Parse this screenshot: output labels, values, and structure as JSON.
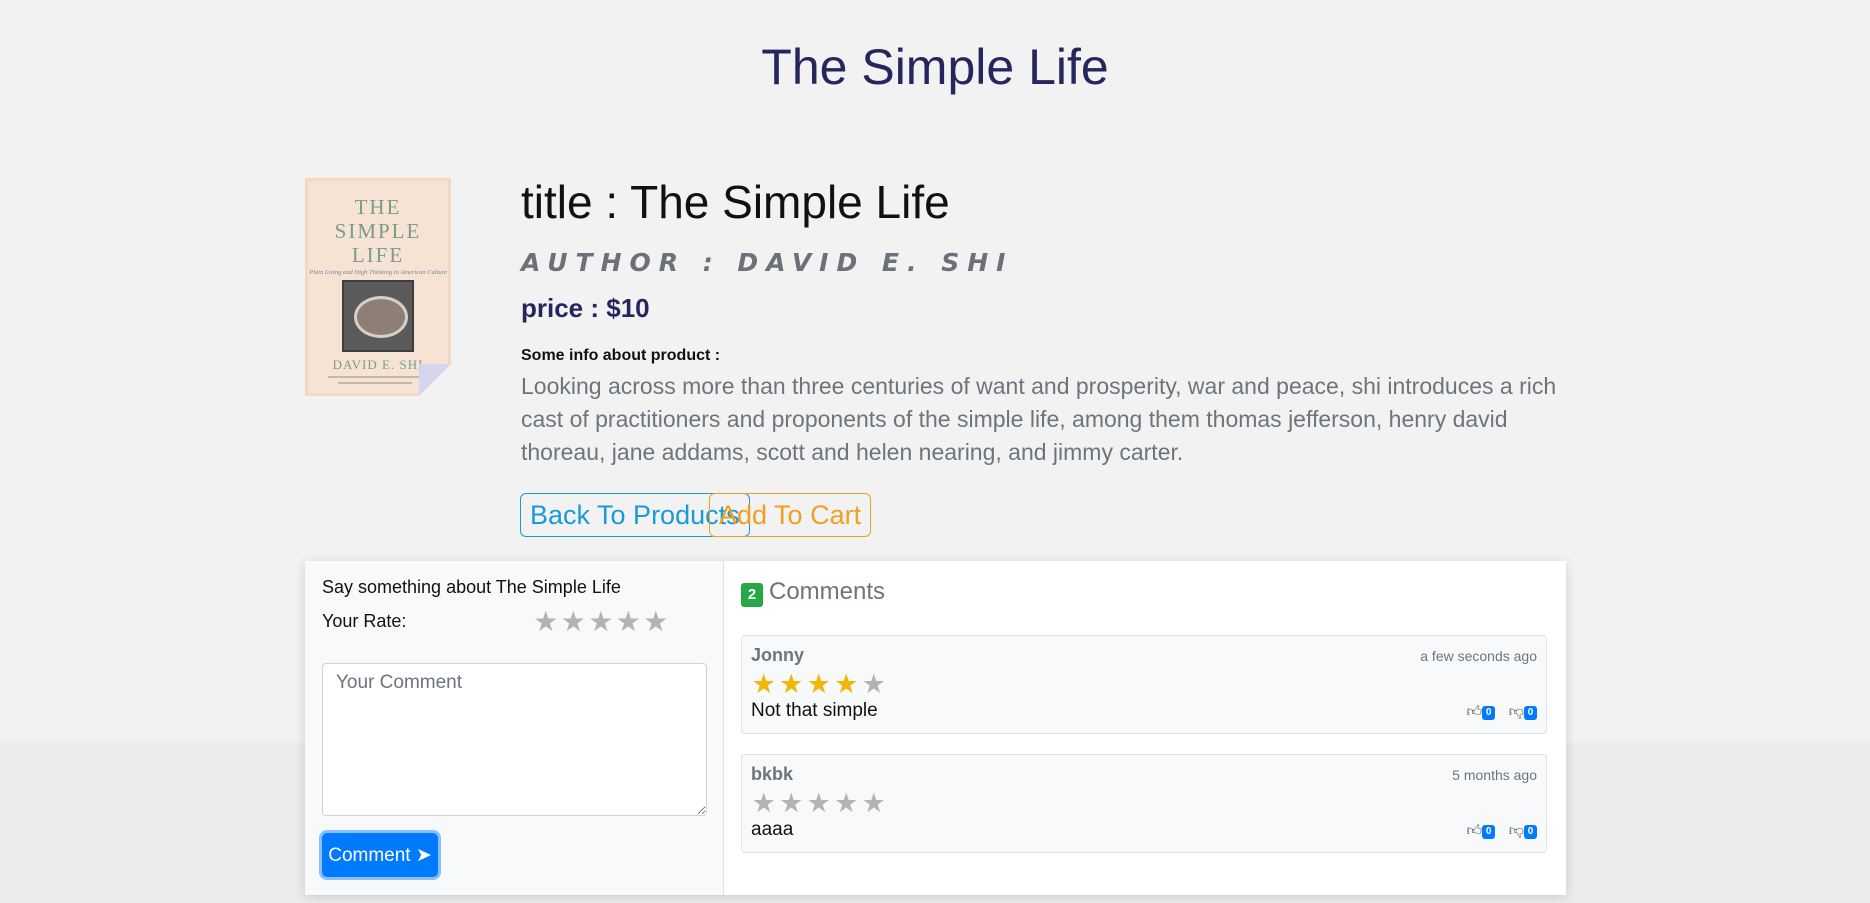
{
  "page": {
    "title": "The Simple Life"
  },
  "cover": {
    "title_line1": "THE",
    "title_line2": "SIMPLE",
    "title_line3": "LIFE",
    "subtitle": "Plain Living and High Thinking in American Culture",
    "author": "DAVID E. SHI"
  },
  "product": {
    "title": "title : The Simple Life",
    "author": "Author : David E. Shi",
    "price": "price : $10",
    "info_label": "Some info about product :",
    "description": "Looking across more than three centuries of want and prosperity, war and peace, shi introduces a rich cast of practitioners and proponents of the simple life, among them thomas jefferson, henry david thoreau, jane addams, scott and helen nearing, and jimmy carter."
  },
  "buttons": {
    "back": "Back To Products",
    "cart": "Add To Cart"
  },
  "form": {
    "prompt": "Say something about The Simple Life",
    "rate_label": "Your Rate:",
    "rate_value": 0,
    "rate_max": 5,
    "comment_placeholder": "Your Comment",
    "submit_label": "Comment ➤"
  },
  "comments": {
    "count": "2",
    "heading": "Comments",
    "items": [
      {
        "user": "Jonny",
        "time": "a few seconds ago",
        "rating": 4,
        "text": "Not that simple",
        "likes": "0",
        "dislikes": "0"
      },
      {
        "user": "bkbk",
        "time": "5 months ago",
        "rating": 0,
        "text": "aaaa",
        "likes": "0",
        "dislikes": "0"
      }
    ]
  },
  "colors": {
    "title": "#26265e",
    "back_button": "#1a9ad6",
    "cart_button": "#f0a020",
    "star_on": "#f2b705",
    "star_off": "#b3b3b3",
    "count_badge": "#28a745",
    "primary": "#007bff"
  },
  "icons": {
    "star": "star-icon",
    "like": "thumbs-up-icon",
    "dislike": "thumbs-down-icon"
  }
}
